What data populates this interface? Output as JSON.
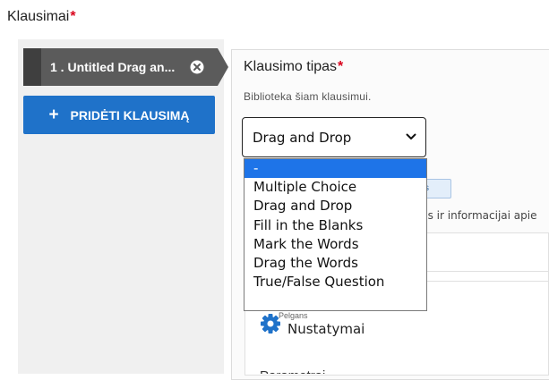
{
  "page": {
    "title": "Klausimai",
    "required_mark": "*"
  },
  "questions_list": {
    "items": [
      {
        "label": "1 . Untitled Drag an..."
      }
    ],
    "add_button": {
      "label": "PRIDĖTI KLAUSIMĄ"
    }
  },
  "question_type": {
    "title": "Klausimo tipas",
    "required_mark": "*",
    "description": "Biblioteka šiam klausimui.",
    "selected": "Drag and Drop",
    "options": [
      "-",
      "Multiple Choice",
      "Drag and Drop",
      "Fill in the Blanks",
      "Mark the Words",
      "Drag the Words",
      "True/False Question"
    ],
    "highlighted_option": "-"
  },
  "background": {
    "tag_fragment": "ys",
    "help_fragment": "ns ir informacijai apie",
    "small_label": "Pelgans",
    "settings_label": "Nustatymai",
    "cut_label": "Parametrai"
  },
  "colors": {
    "accent": "#1f72c9",
    "required": "#d9001b",
    "tab_bg": "#5b5b5b",
    "highlight": "#1e74e8"
  }
}
